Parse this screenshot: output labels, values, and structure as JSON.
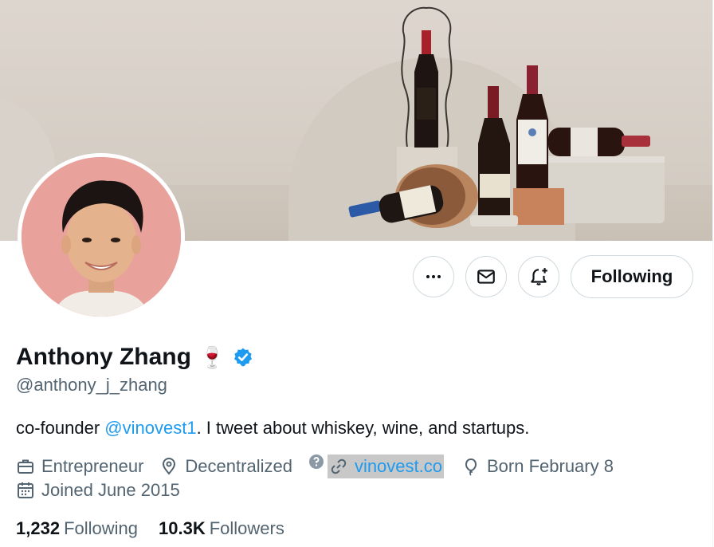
{
  "profile": {
    "name": "Anthony Zhang",
    "name_emoji": "🍷",
    "handle": "@anthony_j_zhang",
    "bio_prefix": "co-founder ",
    "bio_mention": "@vinovest1",
    "bio_suffix": ". I tweet about whiskey, wine, and startups.",
    "profession": "Entrepreneur",
    "location": "Decentralized",
    "website": "vinovest.co",
    "birthday": "Born February 8",
    "joined": "Joined June 2015"
  },
  "stats": {
    "following_count": "1,232",
    "following_label": "Following",
    "followers_count": "10.3K",
    "followers_label": "Followers"
  },
  "actions": {
    "more_icon": "more-icon",
    "message_icon": "envelope-icon",
    "notify_icon": "bell-plus-icon",
    "follow_label": "Following"
  },
  "colors": {
    "accent": "#1d9bf0",
    "secondary_text": "#536471",
    "primary_text": "#0f1419",
    "border": "#cfd9de"
  }
}
